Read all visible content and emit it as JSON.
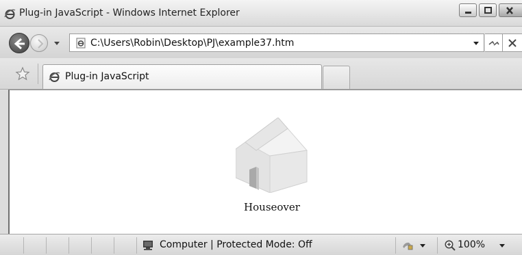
{
  "window": {
    "title": "Plug-in JavaScript - Windows Internet Explorer",
    "minimize_icon": "minimize-icon",
    "maximize_icon": "maximize-icon",
    "close_icon": "close-icon"
  },
  "address": {
    "url": "C:\\Users\\Robin\\Desktop\\PJ\\example37.htm",
    "page_icon": "ie-page-icon",
    "back_icon": "back-arrow-icon",
    "forward_icon": "forward-arrow-icon",
    "refresh_icon": "refresh-icon",
    "stop_icon": "stop-icon"
  },
  "tabs": [
    {
      "label": "Plug-in JavaScript",
      "active": true
    }
  ],
  "favorites_icon": "star-icon",
  "content": {
    "image_icon": "house-icon",
    "caption": "Houseover"
  },
  "status": {
    "zone": "Computer | Protected Mode: Off",
    "zoom": "100%"
  },
  "colors": {
    "chrome": "#d9d9d9",
    "page": "#ffffff",
    "text": "#111111"
  }
}
